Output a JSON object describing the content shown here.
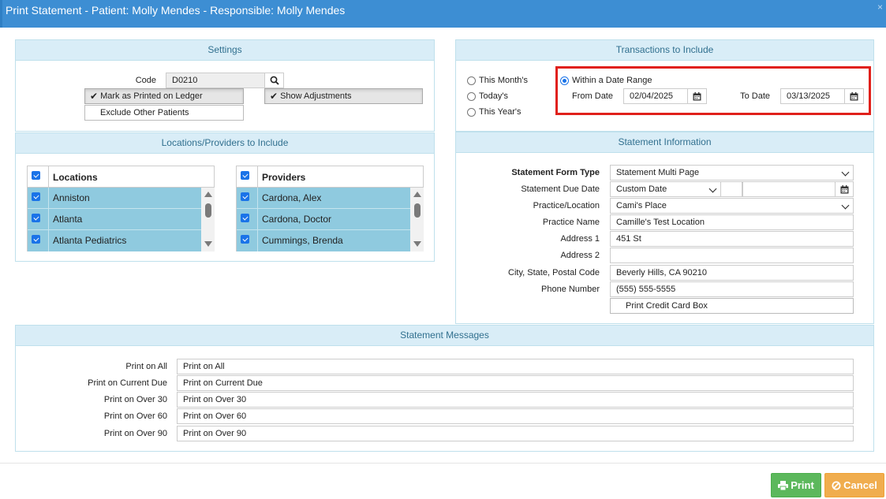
{
  "window": {
    "title": "Print Statement - Patient: Molly Mendes - Responsible: Molly Mendes",
    "close": "×"
  },
  "settings": {
    "header": "Settings",
    "code_label": "Code",
    "code_value": "D0210",
    "mark_printed": "Mark as Printed on Ledger",
    "show_adjustments": "Show Adjustments",
    "exclude_other": "Exclude Other Patients"
  },
  "transactions": {
    "header": "Transactions to Include",
    "this_month": "This Month's",
    "today": "Today's",
    "this_year": "This Year's",
    "date_range": "Within a Date Range",
    "from_label": "From Date",
    "from_value": "02/04/2025",
    "to_label": "To Date",
    "to_value": "03/13/2025",
    "selected": "date_range"
  },
  "locations_providers": {
    "header": "Locations/Providers to Include",
    "locations_title": "Locations",
    "locations": [
      "Anniston",
      "Atlanta",
      "Atlanta Pediatrics"
    ],
    "providers_title": "Providers",
    "providers": [
      "Cardona, Alex",
      "Cardona, Doctor",
      "Cummings, Brenda"
    ]
  },
  "statement_info": {
    "header": "Statement Information",
    "form_type_label": "Statement Form Type",
    "form_type_value": "Statement Multi Page",
    "due_date_label": "Statement Due Date",
    "due_date_value": "Custom Date",
    "due_date_custom": "",
    "practice_location_label": "Practice/Location",
    "practice_location_value": "Cami's Place",
    "practice_name_label": "Practice Name",
    "practice_name_value": "Camille's Test Location",
    "address1_label": "Address 1",
    "address1_value": "451 St",
    "address2_label": "Address 2",
    "address2_value": "",
    "city_label": "City, State, Postal Code",
    "city_value": "Beverly Hills, CA 90210",
    "phone_label": "Phone Number",
    "phone_value": "(555) 555-5555",
    "credit_card_box": "Print Credit Card Box"
  },
  "messages": {
    "header": "Statement Messages",
    "rows": [
      {
        "label": "Print on All",
        "value": "Print on All"
      },
      {
        "label": "Print on Current Due",
        "value": "Print on Current Due"
      },
      {
        "label": "Print on Over 30",
        "value": "Print on Over 30"
      },
      {
        "label": "Print on Over 60",
        "value": "Print on Over 60"
      },
      {
        "label": "Print on Over 90",
        "value": "Print on Over 90"
      }
    ]
  },
  "footer": {
    "print": "Print",
    "cancel": "Cancel"
  },
  "colors": {
    "title_bar": "#3d8ed3",
    "panel_header": "#d9edf7",
    "selected_row": "#8fcadf",
    "highlight": "#e0201b",
    "print_button": "#5cb85c",
    "cancel_button": "#f0ad4e"
  }
}
